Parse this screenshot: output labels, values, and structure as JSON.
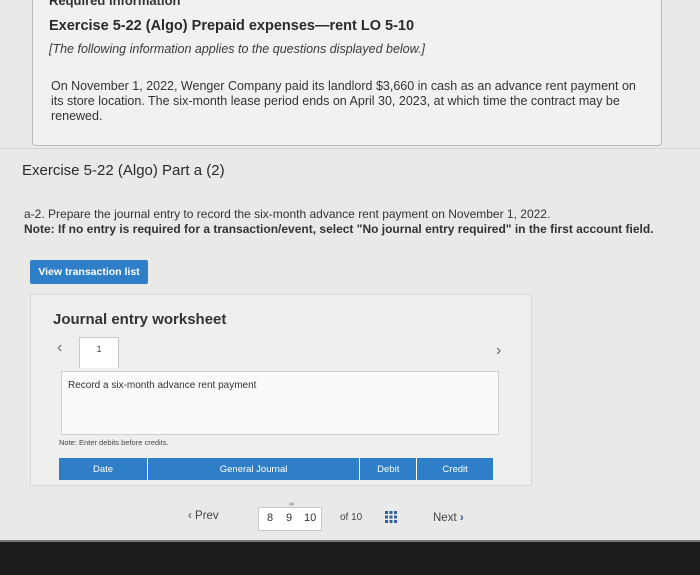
{
  "info": {
    "required_heading": "Required information",
    "exercise_title": "Exercise 5-22 (Algo) Prepaid expenses—rent LO 5-10",
    "applies_note": "[The following information applies to the questions displayed below.]",
    "paragraph": "On November 1, 2022, Wenger Company paid its landlord $3,660 in cash as an advance rent payment on its store location. The six-month lease period ends on April 30, 2023, at which time the contract may be renewed."
  },
  "part": {
    "title": "Exercise 5-22 (Algo) Part a (2)",
    "instruction_lead": "a-2.",
    "instruction": " Prepare the journal entry to record the six-month advance rent payment on November 1, 2022.",
    "note": "Note: If no entry is required for a transaction/event, select \"No journal entry required\" in the first account field."
  },
  "view_button": "View transaction list",
  "worksheet": {
    "title": "Journal entry worksheet",
    "page_number": "1",
    "description": "Record a six-month advance rent payment",
    "note": "Note: Enter debits before credits.",
    "columns": [
      "Date",
      "General Journal",
      "Debit",
      "Credit"
    ]
  },
  "pager": {
    "prev": "Prev",
    "pages": [
      "8",
      "9",
      "10"
    ],
    "of": "of 10",
    "next": "Next"
  },
  "colors": {
    "accent": "#2f7fc8"
  }
}
